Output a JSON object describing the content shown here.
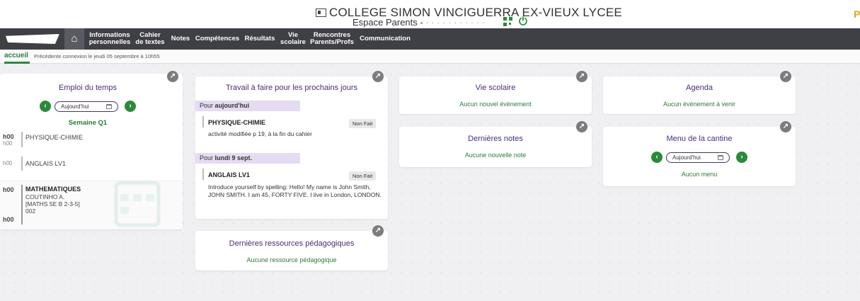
{
  "header": {
    "school_name": "COLLEGE SIMON VINCIGUERRA EX-VIEUX LYCEE",
    "espace": "Espace Parents - ",
    "corner_letter": "P"
  },
  "nav": {
    "items": [
      {
        "label": "Informations personnelles"
      },
      {
        "label": "Cahier de textes"
      },
      {
        "label": "Notes"
      },
      {
        "label": "Compétences"
      },
      {
        "label": "Résultats"
      },
      {
        "label": "Vie scolaire"
      },
      {
        "label": "Rencontres Parents/Profs"
      },
      {
        "label": "Communication"
      }
    ]
  },
  "subbar": {
    "active": "accueil",
    "last_connection": "Précédente connexion le jeudi 05 septembre à 10h55"
  },
  "emploi": {
    "title": "Emploi du temps",
    "date_value": "Aujourd'hui",
    "week": "Semaine Q1",
    "rows": [
      {
        "time": "h00",
        "time2": "h00",
        "subject": "PHYSIQUE-CHIMIE"
      },
      {
        "time": "h00",
        "subject": "ANGLAIS LV1"
      },
      {
        "time": "h00",
        "time2": "h00",
        "subject": "MATHEMATIQUES",
        "teacher": "COUTINHO A.",
        "group": "[MATHS 5E B 2-3-5]",
        "room": "002"
      }
    ]
  },
  "travail": {
    "title": "Travail à faire pour les prochains jours",
    "groups": [
      {
        "prefix": "Pour ",
        "day": "aujourd'hui",
        "subject": "PHYSIQUE-CHIMIE",
        "status": "Non Fait",
        "desc": "activité modifiée p 19, à la fin du cahier"
      },
      {
        "prefix": "Pour ",
        "day": "lundi 9 sept.",
        "subject": "ANGLAIS LV1",
        "status": "Non Fait",
        "desc": "Introduce yourself by spelling: Hello! My name is John Smith, JOHN SMITH. I am 45, FORTY FIVE. I live in London, LONDON."
      }
    ]
  },
  "ressources": {
    "title": "Dernières ressources pédagogiques",
    "empty": "Aucune ressource pédagogique"
  },
  "vie_scolaire": {
    "title": "Vie scolaire",
    "empty": "Aucun nouvel évènement"
  },
  "notes": {
    "title": "Dernières notes",
    "empty": "Aucune nouvelle note"
  },
  "agenda": {
    "title": "Agenda",
    "empty": "Aucun évènement à venir"
  },
  "cantine": {
    "title": "Menu de la cantine",
    "date_value": "Aujourd'hui",
    "empty": "Aucun menu"
  },
  "icons": {
    "expand": "expand-arrow-icon",
    "prev": "chevron-left-icon",
    "next": "chevron-right-icon",
    "calendar": "calendar-icon",
    "home": "home-icon",
    "qr": "qr-code-icon",
    "power": "power-icon"
  },
  "colors": {
    "nav_bg": "#3f3f46",
    "accent_green": "#2a8a3a",
    "title_purple": "#4a2c7a",
    "section_lilac": "#e5dbf3"
  }
}
